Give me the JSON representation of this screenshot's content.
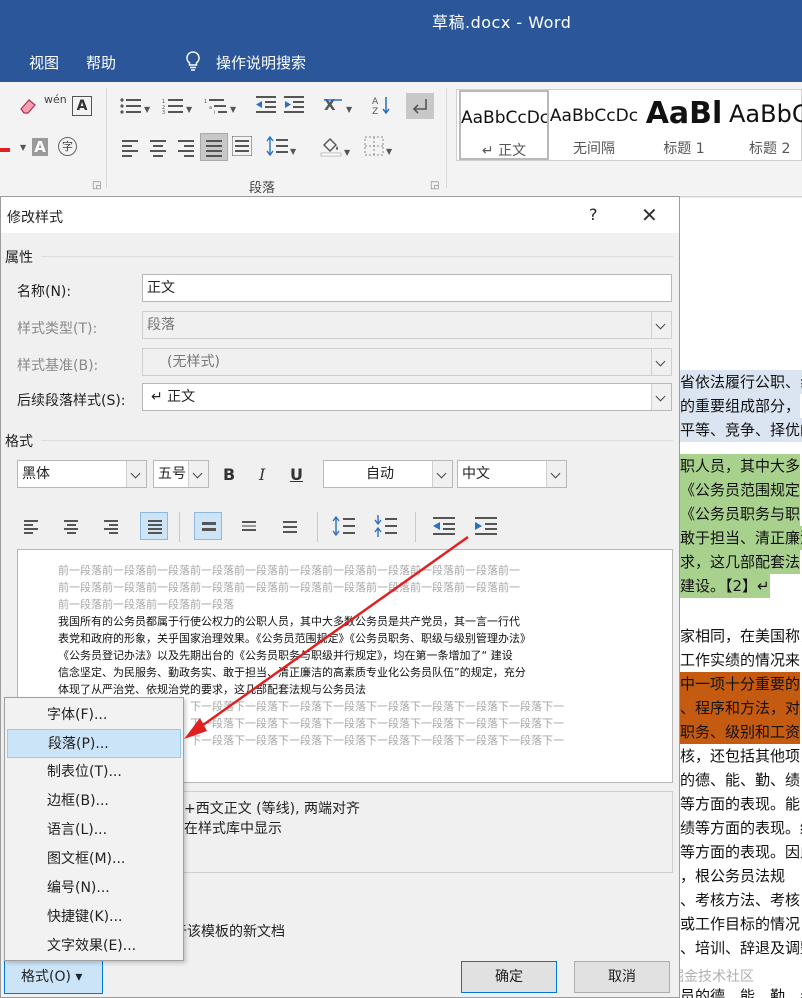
{
  "window": {
    "title": "草稿.docx  -  Word"
  },
  "menu": {
    "partial_item": "",
    "view": "视图",
    "help": "帮助",
    "tell_me": "操作说明搜索"
  },
  "ribbon": {
    "paragraph_group_label": "段落",
    "styles": [
      {
        "preview": "AaBbCcDc",
        "name": "↵ 正文"
      },
      {
        "preview": "AaBbCcDc",
        "name": "无间隔"
      },
      {
        "preview": "AaBl",
        "name": "标题 1"
      },
      {
        "preview": "AaBbC",
        "name": "标题 2"
      }
    ],
    "font_glyphs": {
      "pinyin": "wén",
      "char_border": "A",
      "shade_a": "A",
      "enclose": "字"
    }
  },
  "dialog": {
    "title": "修改样式",
    "help": "?",
    "close": "✕",
    "properties_header": "属性",
    "name_label": "名称(N):",
    "name_value": "正文",
    "style_type_label": "样式类型(T):",
    "style_type_value": "段落",
    "based_on_label": "样式基准(B):",
    "based_on_value": "(无样式)",
    "following_label": "后续段落样式(S):",
    "following_value": "↵ 正文",
    "format_header": "格式",
    "font_value": "黑体",
    "size_value": "五号",
    "bold": "B",
    "italic": "I",
    "underline": "U",
    "color_value": "自动",
    "lang_value": "中文",
    "preview": {
      "prev_lines": [
        "前一段落前一段落前一段落前一段落前一段落前一段落前一段落前一段落前一段落前一段落前一",
        "前一段落前一段落前一段落前一段落前一段落前一段落前一段落前一段落前一段落前一段落前一",
        "前一段落前一段落前一段落前一段落"
      ],
      "main_lines": [
        "我国所有的公务员都属于行使公权力的公职人员，其中大多数公务员是共产党员，其一言一行代",
        "表党和政府的形象，关乎国家治理效果。《公务员范围规定》《公务员职务、职级与级别管理办法》",
        "《公务员登记办法》以及先期出台的《公务员职务与职级并行规定》，均在第一条增加了“ 建设",
        "信念坚定、为民服务、勤政务实、敢于担当、清正廉洁的高素质专业化公务员队伍”的规定，充分",
        "体现了从严治党、依规治党的要求，这几部配套法规与公务员法"
      ],
      "next_lines": [
        "下一段落下一段落下一段落下一段落下一段落下一段落下一段落下一段落下一",
        "下一段落下一段落下一段落下一段落下一段落下一段落下一段落下一段落下一",
        "下一段落下一段落下一段落下一段落下一段落下一段落下一段落下一段落下一"
      ]
    },
    "description_lines": [
      "+西文正文 (等线), 两端对齐",
      "在样式库中显示"
    ],
    "template_text": "于该模板的新文档",
    "format_button": "格式(O) ▾",
    "ok": "确定",
    "cancel": "取消"
  },
  "format_menu": [
    {
      "label": "字体(F)...",
      "highlighted": false
    },
    {
      "label": "段落(P)...",
      "highlighted": true
    },
    {
      "label": "制表位(T)...",
      "highlighted": false
    },
    {
      "label": "边框(B)...",
      "highlighted": false
    },
    {
      "label": "语言(L)...",
      "highlighted": false
    },
    {
      "label": "图文框(M)...",
      "highlighted": false
    },
    {
      "label": "编号(N)...",
      "highlighted": false
    },
    {
      "label": "快捷键(K)...",
      "highlighted": false
    },
    {
      "label": "文字效果(E)...",
      "highlighted": false
    }
  ],
  "document": {
    "lines": [
      "省依法履行公职、纟",
      "的重要组成部分，",
      "平等、竞争、择优的",
      "职人员，其中大多",
      "《公务员范围规定",
      "《公务员职务与职",
      "敢于担当、清正廉洁",
      "求，这几部配套法",
      "建设。【2】↵",
      "家相同，在美国称え",
      "工作实绩的情况来",
      "中一项十分重要的",
      "、程序和方法，对",
      "职务、级别和工资",
      "核，还包括其他项",
      "的德、能、勤、绩",
      "等方面的表现。能",
      "绩等方面的表现。结",
      "等方面的表现。因此",
      "，根公务员法规",
      "、考核方法、考核",
      "或工作目标的情况",
      "、培训、辞退及调整",
      "员的德、能、勤、纟",
      "更加有效地对公务员",
      "非执行职务非职"
    ]
  },
  "watermark": "@稀土掘金技术社区",
  "colors": {
    "title_bar": "#2b579a",
    "arrow": "#e02020",
    "menu_highlight": "#cce4f7"
  }
}
